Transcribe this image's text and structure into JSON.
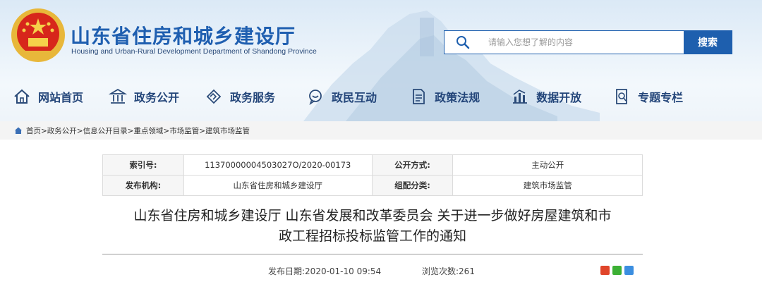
{
  "header": {
    "title": "山东省住房和城乡建设厅",
    "subtitle": "Housing and Urban-Rural Development Department of Shandong Province"
  },
  "search": {
    "placeholder": "请输入您想了解的内容",
    "button_label": "搜索"
  },
  "nav": {
    "items": [
      {
        "label": "网站首页",
        "icon": "home-icon"
      },
      {
        "label": "政务公开",
        "icon": "building-icon"
      },
      {
        "label": "政务服务",
        "icon": "handshake-icon"
      },
      {
        "label": "政民互动",
        "icon": "chat-icon"
      },
      {
        "label": "政策法规",
        "icon": "document-icon"
      },
      {
        "label": "数据开放",
        "icon": "chart-icon"
      },
      {
        "label": "专题专栏",
        "icon": "topic-icon"
      }
    ]
  },
  "breadcrumb": {
    "text": "首页>政务公开>信息公开目录>重点领域>市场监管>建筑市场监管"
  },
  "meta": {
    "index_label": "索引号:",
    "index_value": "11370000004503027O/2020-00173",
    "method_label": "公开方式:",
    "method_value": "主动公开",
    "publisher_label": "发布机构:",
    "publisher_value": "山东省住房和城乡建设厅",
    "category_label": "组配分类:",
    "category_value": "建筑市场监管"
  },
  "article": {
    "title_line1": "山东省住房和城乡建设厅 山东省发展和改革委员会 关于进一步做好房屋建筑和市",
    "title_line2": "政工程招标投标监管工作的通知",
    "publish_date": "发布日期:2020-01-10 09:54",
    "view_count": "浏览次数:261"
  },
  "colors": {
    "brand_blue": "#1e5fae",
    "nav_text": "#24467a",
    "emblem_red": "#d7261b"
  }
}
